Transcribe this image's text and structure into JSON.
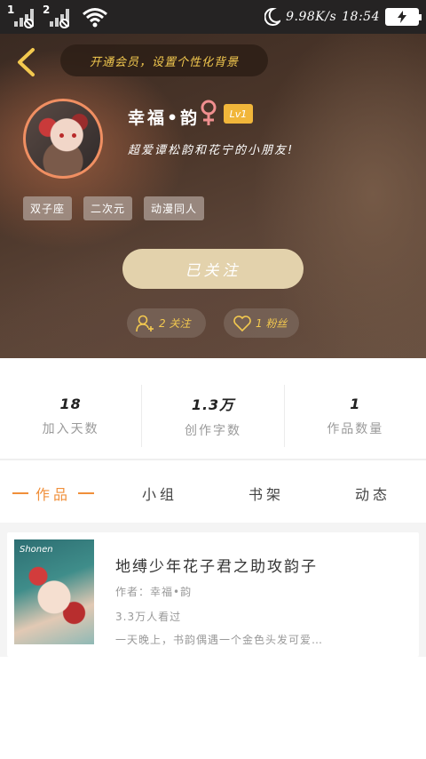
{
  "status_bar": {
    "sim1": "1",
    "sim2": "2",
    "net_speed": "9.98K/s",
    "time": "18:54"
  },
  "header": {
    "vip_banner": "开通会员，设置个性化背景",
    "user_name": "幸福•韵",
    "level": "Lv1",
    "bio": "超爱谭松韵和花宁的小朋友!",
    "tags": [
      "双子座",
      "二次元",
      "动漫同人"
    ],
    "follow_button": "已关注",
    "following": "2 关注",
    "fans": "1 粉丝"
  },
  "stats": [
    {
      "value": "18",
      "label": "加入天数"
    },
    {
      "value": "1.3万",
      "label": "创作字数"
    },
    {
      "value": "1",
      "label": "作品数量"
    }
  ],
  "tabs": [
    "作品",
    "小组",
    "书架",
    "动态"
  ],
  "works": [
    {
      "cover_text": "Shonen",
      "title": "地缚少年花子君之助攻韵子",
      "author": "作者：幸福•韵",
      "views": "3.3万人看过",
      "summary": "一天晚上，书韵偶遇一个金色头发可爱…"
    }
  ],
  "colors": {
    "accent": "#f08f3a",
    "follow_button": "#e3d2ac",
    "level_badge": "#f1b63a",
    "vip_text": "#f3c94f"
  }
}
